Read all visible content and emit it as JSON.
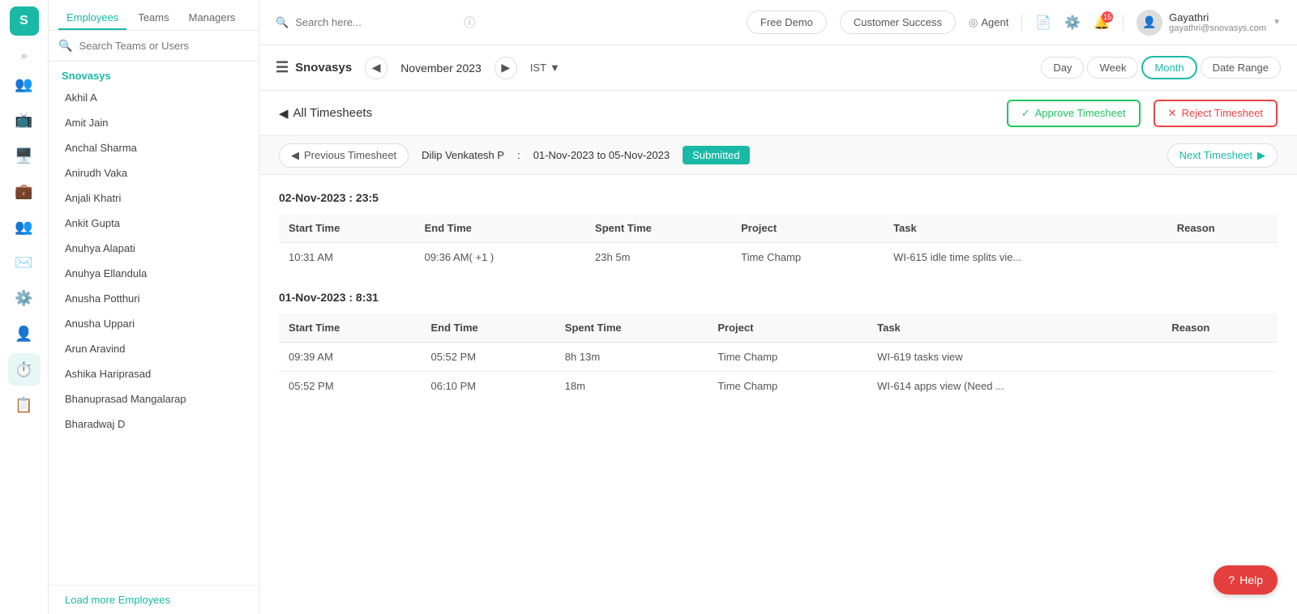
{
  "app": {
    "logo_text": "S",
    "logo_bg": "#1ab9a6"
  },
  "header": {
    "search_placeholder": "Search here...",
    "free_demo_label": "Free Demo",
    "customer_success_label": "Customer Success",
    "agent_label": "Agent",
    "notification_count": "15",
    "user": {
      "name": "Gayathri",
      "email": "gayathri@snovasys.com"
    }
  },
  "sidebar": {
    "tabs": [
      "Employees",
      "Teams",
      "Managers"
    ],
    "active_tab": "Employees",
    "search_placeholder": "Search Teams or Users",
    "section_title": "Snovasys",
    "employees": [
      "Akhil A",
      "Amit Jain",
      "Anchal Sharma",
      "Anirudh Vaka",
      "Anjali Khatri",
      "Ankit Gupta",
      "Anuhya Alapati",
      "Anuhya Ellandula",
      "Anusha Potthuri",
      "Anusha Uppari",
      "Arun Aravind",
      "Ashika Hariprasad",
      "Bhanuprasad Mangalarap",
      "Bharadwaj D"
    ],
    "load_more_label": "Load more Employees"
  },
  "timesheet_header": {
    "brand_label": "Snovasys",
    "month_display": "November 2023",
    "timezone": "IST",
    "view_buttons": [
      "Day",
      "Week",
      "Month",
      "Date Range"
    ],
    "active_view": "Month"
  },
  "action_bar": {
    "back_label": "All Timesheets",
    "approve_label": "Approve Timesheet",
    "reject_label": "Reject Timesheet"
  },
  "timesheet_nav": {
    "prev_label": "Previous Timesheet",
    "employee_name": "Dilip Venkatesh P",
    "date_range": "01-Nov-2023 to 05-Nov-2023",
    "status": "Submitted",
    "next_label": "Next Timesheet"
  },
  "sections": [
    {
      "date_heading": "02-Nov-2023 : 23:5",
      "columns": [
        "Start Time",
        "End Time",
        "Spent Time",
        "Project",
        "Task",
        "Reason"
      ],
      "rows": [
        {
          "start_time": "10:31 AM",
          "end_time": "09:36 AM( +1 )",
          "spent_time": "23h 5m",
          "project": "Time Champ",
          "task": "WI-615 idle time splits vie...",
          "reason": ""
        }
      ]
    },
    {
      "date_heading": "01-Nov-2023 : 8:31",
      "columns": [
        "Start Time",
        "End Time",
        "Spent Time",
        "Project",
        "Task",
        "Reason"
      ],
      "rows": [
        {
          "start_time": "09:39 AM",
          "end_time": "05:52 PM",
          "spent_time": "8h 13m",
          "project": "Time Champ",
          "task": "WI-619 tasks view",
          "reason": ""
        },
        {
          "start_time": "05:52 PM",
          "end_time": "06:10 PM",
          "spent_time": "18m",
          "project": "Time Champ",
          "task": "WI-614 apps view (Need ...",
          "reason": ""
        }
      ]
    }
  ],
  "help_button": {
    "label": "Help"
  },
  "icons": {
    "hamburger": "☰",
    "search": "🔍",
    "back_arrow": "◀",
    "forward_arrow": "▶",
    "left_angle": "❮",
    "right_angle": "❯",
    "check": "✓",
    "cross": "✕",
    "clock": "🕐",
    "agent_icon": "◎",
    "document": "📄",
    "settings": "⚙",
    "bell": "🔔",
    "user_avatar": "👤",
    "help": "?"
  }
}
